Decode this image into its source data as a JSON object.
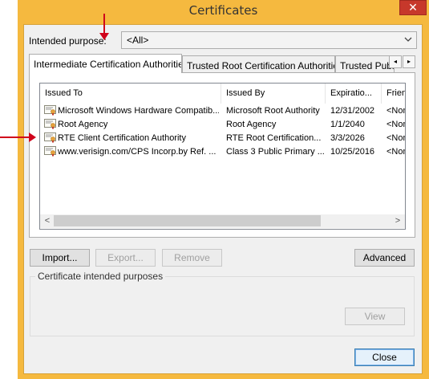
{
  "window": {
    "title": "Certificates",
    "close_glyph": "✕"
  },
  "purpose": {
    "label": "Intended purpose:",
    "value": "<All>"
  },
  "tabs": [
    {
      "label": "Intermediate Certification Authorities"
    },
    {
      "label": "Trusted Root Certification Authorities"
    },
    {
      "label": "Trusted Publ"
    }
  ],
  "tab_scroll": {
    "left": "◂",
    "right": "▸"
  },
  "columns": [
    "Issued To",
    "Issued By",
    "Expiratio...",
    "Frien"
  ],
  "rows": [
    {
      "issued_to": "Microsoft Windows Hardware Compatib...",
      "issued_by": "Microsoft Root Authority",
      "expiration": "12/31/2002",
      "friendly": "<Non"
    },
    {
      "issued_to": "Root Agency",
      "issued_by": "Root Agency",
      "expiration": "1/1/2040",
      "friendly": "<Non"
    },
    {
      "issued_to": "RTE Client Certification Authority",
      "issued_by": "RTE Root Certification...",
      "expiration": "3/3/2026",
      "friendly": "<Non"
    },
    {
      "issued_to": "www.verisign.com/CPS Incorp.by Ref. ...",
      "issued_by": "Class 3 Public Primary ...",
      "expiration": "10/25/2016",
      "friendly": "<Non"
    }
  ],
  "scroll": {
    "left": "<",
    "right": ">"
  },
  "buttons": {
    "import": "Import...",
    "export": "Export...",
    "remove": "Remove",
    "advanced": "Advanced",
    "view": "View",
    "close": "Close"
  },
  "group": {
    "label": "Certificate intended purposes"
  },
  "colors": {
    "window_frame": "#f5b93f",
    "close_button": "#c7382b",
    "annotation_arrow": "#d0021b"
  },
  "icons": {
    "certificate": "certificate-icon"
  }
}
